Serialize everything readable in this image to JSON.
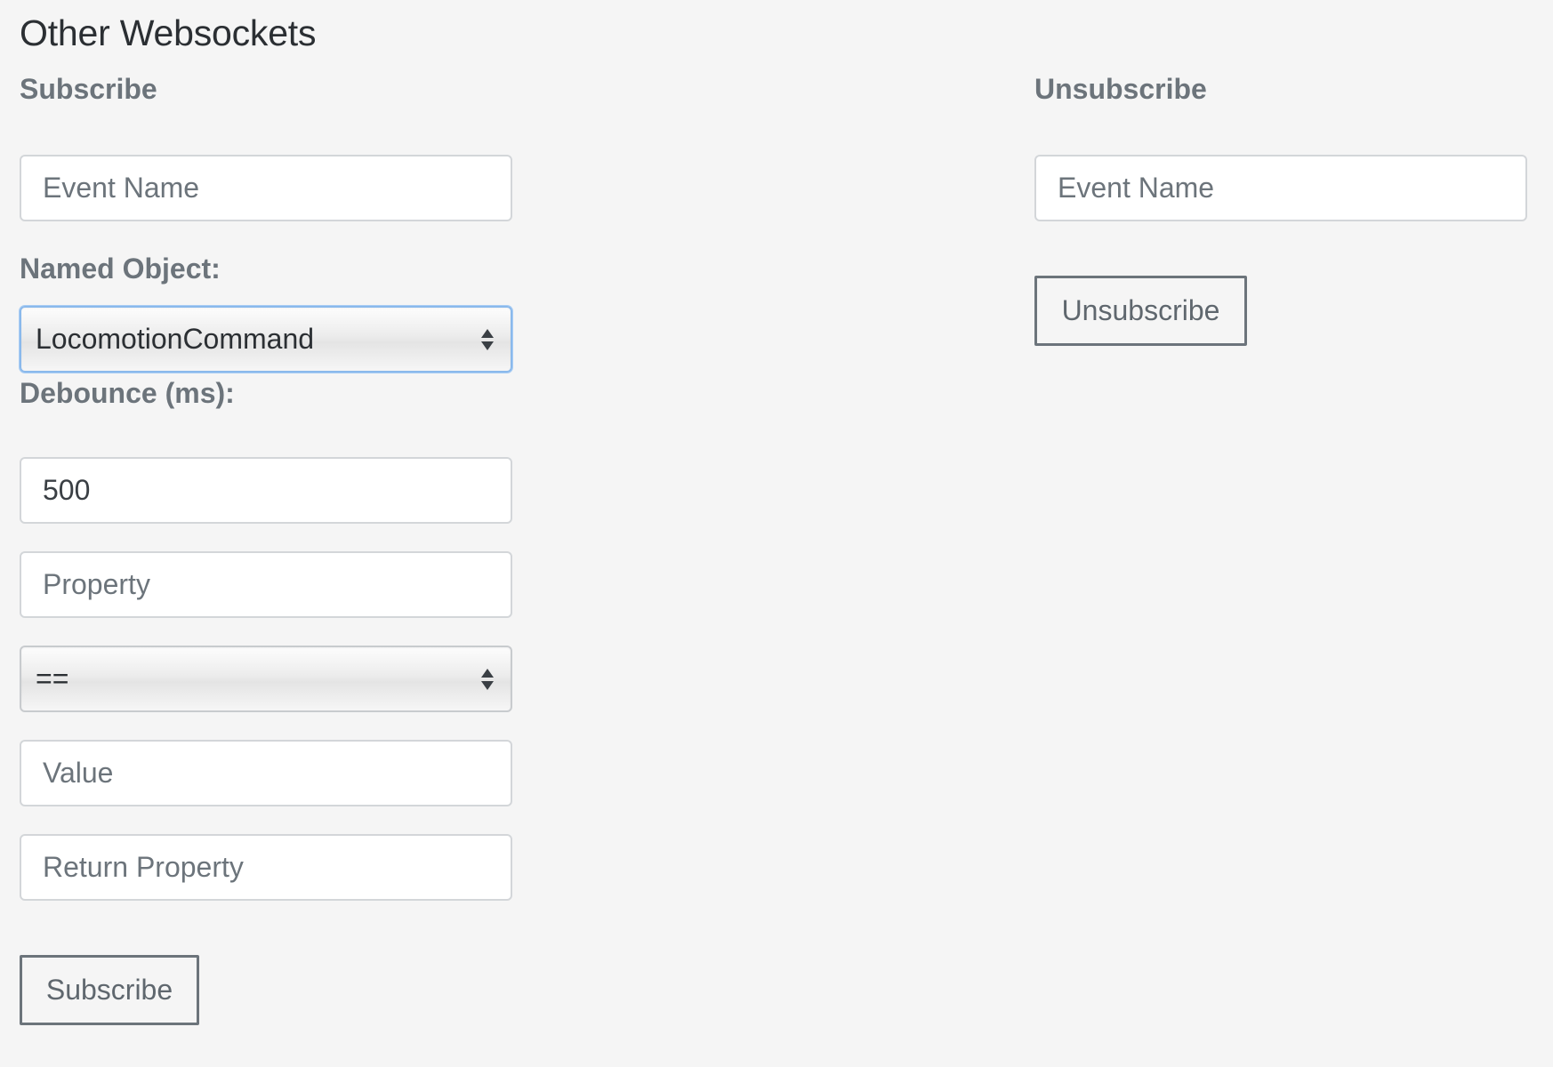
{
  "page": {
    "title": "Other Websockets"
  },
  "subscribe": {
    "heading": "Subscribe",
    "event_name": {
      "value": "",
      "placeholder": "Event Name"
    },
    "named_object_label": "Named Object:",
    "named_object_select": {
      "selected": "LocomotionCommand"
    },
    "debounce_label": "Debounce (ms):",
    "debounce": {
      "value": "500",
      "placeholder": ""
    },
    "property": {
      "value": "",
      "placeholder": "Property"
    },
    "operator_select": {
      "selected": "=="
    },
    "value_field": {
      "value": "",
      "placeholder": "Value"
    },
    "return_property": {
      "value": "",
      "placeholder": "Return Property"
    },
    "button_label": "Subscribe"
  },
  "unsubscribe": {
    "heading": "Unsubscribe",
    "event_name": {
      "value": "",
      "placeholder": "Event Name"
    },
    "button_label": "Unsubscribe"
  },
  "colors": {
    "background": "#f5f5f5",
    "heading_text": "#6c747b",
    "title_text": "#2b2f33",
    "focus_border": "#8ab9ec"
  },
  "icons": {
    "select_arrows": "chevron-up-down-icon"
  }
}
